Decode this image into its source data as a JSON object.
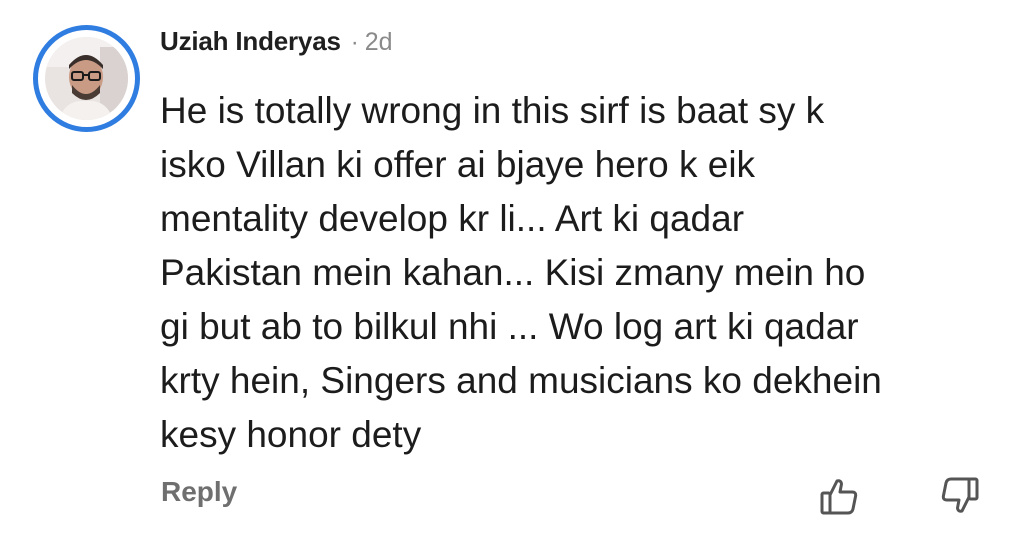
{
  "comment": {
    "author": "Uziah Inderyas",
    "separator": "·",
    "age": "2d",
    "text": "He is totally wrong in this sirf is baat sy k\nisko Villan ki offer ai bjaye hero k eik\nmentality develop kr li... Art ki qadar\nPakistan mein kahan... Kisi zmany mein ho\ngi but ab to bilkul nhi ... Wo log art ki qadar\nkrty hein, Singers and musicians ko dekhein\nkesy honor dety",
    "reply_label": "Reply",
    "icons": {
      "avatar": "user-avatar",
      "upvote": "thumbs-up-icon",
      "downvote": "thumbs-down-icon"
    },
    "colors": {
      "avatar_ring": "#2f7de1",
      "author_text": "#1f1f1f",
      "meta_text": "#8a8a8a",
      "reply_text": "#6f6f6f"
    }
  }
}
